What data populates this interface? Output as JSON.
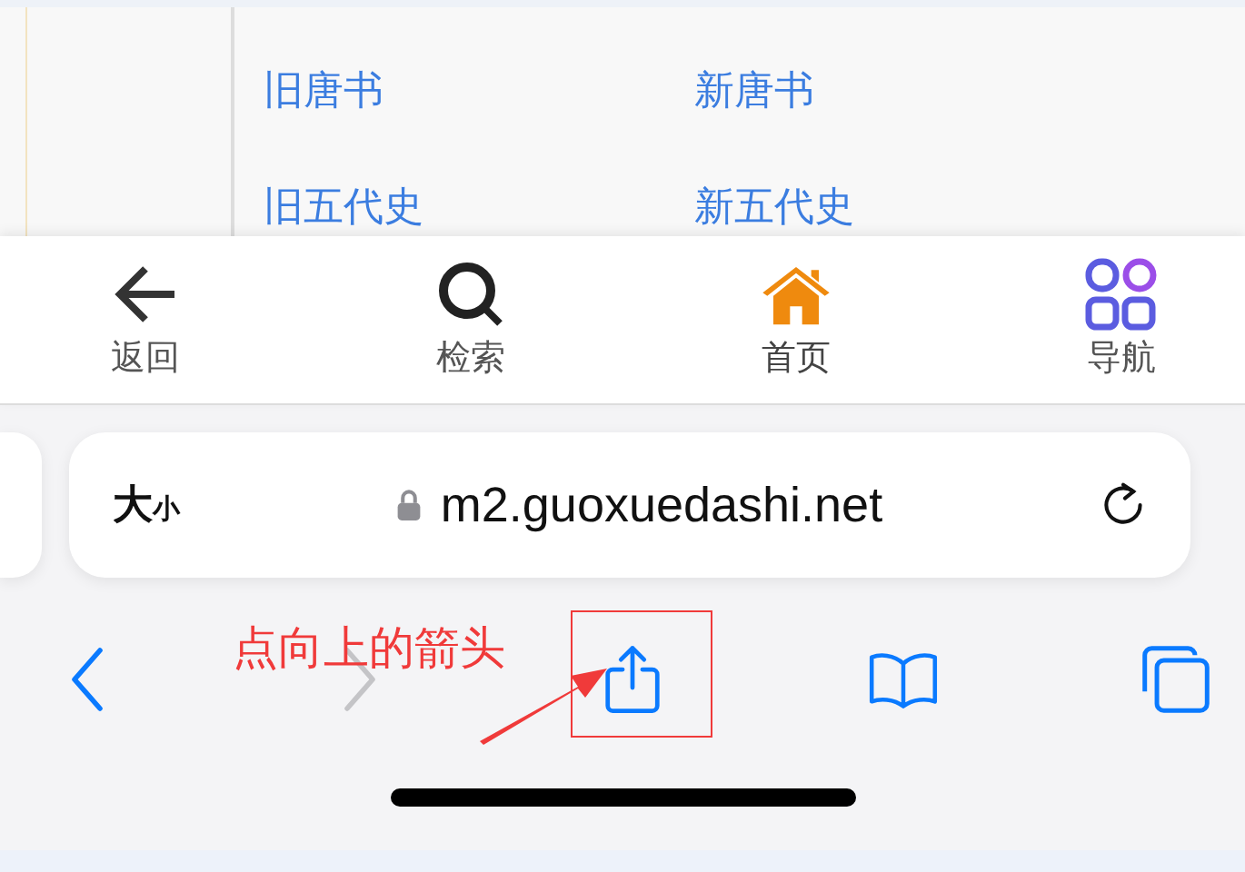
{
  "page": {
    "links": [
      {
        "label": "旧唐书"
      },
      {
        "label": "新唐书"
      },
      {
        "label": "旧五代史"
      },
      {
        "label": "新五代史"
      }
    ]
  },
  "site_nav": [
    {
      "label": "返回",
      "kind": "back",
      "selected": false
    },
    {
      "label": "检索",
      "kind": "search",
      "selected": false
    },
    {
      "label": "首页",
      "kind": "home",
      "selected": true
    },
    {
      "label": "导航",
      "kind": "grid",
      "selected": false
    }
  ],
  "address_bar": {
    "text_size_big": "大",
    "text_size_small": "小",
    "url": "m2.guoxuedashi.net"
  },
  "toolbar": [
    {
      "kind": "back",
      "disabled": false
    },
    {
      "kind": "forward",
      "disabled": true
    },
    {
      "kind": "share",
      "disabled": false
    },
    {
      "kind": "bookmarks",
      "disabled": false
    },
    {
      "kind": "tabs",
      "disabled": false
    }
  ],
  "annotation": {
    "text": "点向上的箭头"
  }
}
